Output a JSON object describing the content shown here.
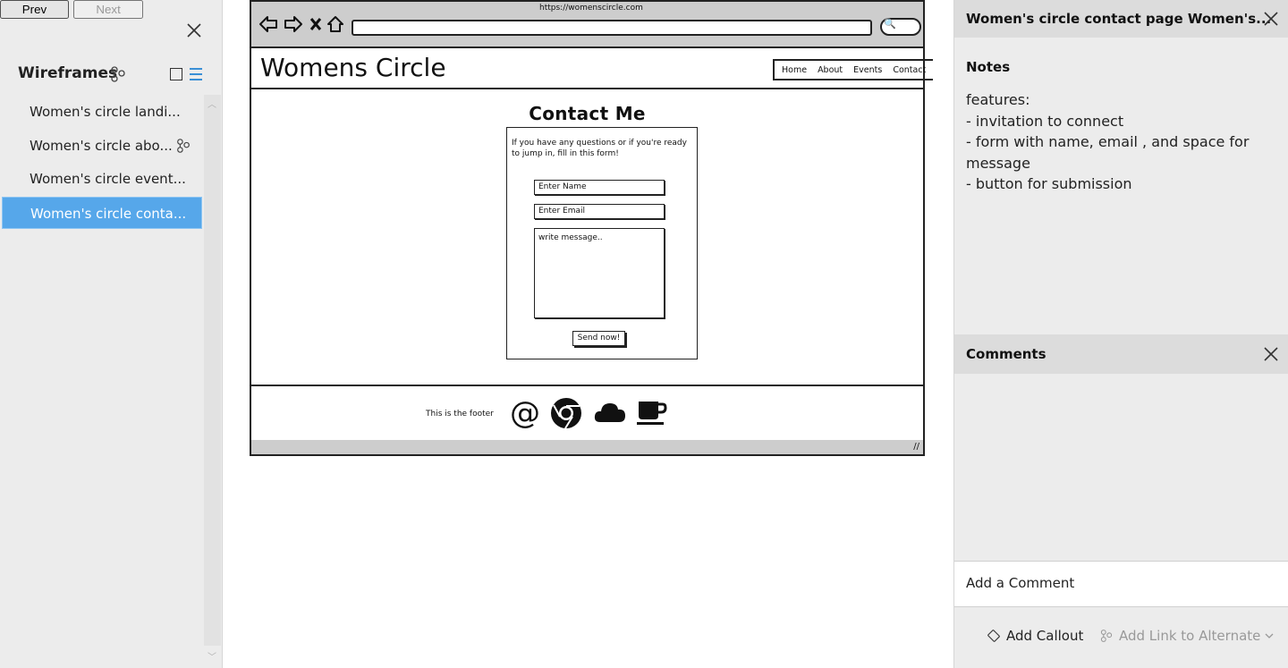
{
  "left": {
    "prev_label": "Prev",
    "next_label": "Next",
    "title": "Wireframes",
    "items": [
      {
        "label": "Women's circle landi...",
        "selected": false
      },
      {
        "label": "Women's circle abo...",
        "selected": false
      },
      {
        "label": "Women's circle event...",
        "selected": false
      },
      {
        "label": "Women's circle conta...",
        "selected": true
      }
    ]
  },
  "wireframe": {
    "url": "https://womenscircle.com",
    "site_title": "Womens Circle",
    "nav": [
      "Home",
      "About",
      "Events",
      "Contact"
    ],
    "heading": "Contact Me",
    "intro": "If you have any questions or if you're ready to jump in, fill in this form!",
    "name_placeholder": "Enter Name",
    "email_placeholder": "Enter Email",
    "message_placeholder": "write message..",
    "send_label": "Send now!",
    "footer_text": "This is the footer"
  },
  "right": {
    "title": "Women's circle contact page Women's...",
    "notes_label": "Notes",
    "notes_lines": [
      "features:",
      "- invitation to connect",
      "- form with name, email , and space for message",
      "- button for submission"
    ],
    "comments_title": "Comments",
    "add_comment": "Add a Comment",
    "add_callout": "Add Callout",
    "add_link": "Add Link to Alternate"
  },
  "colors": {
    "selection": "#56a7ea",
    "accent": "#3a8fd6"
  }
}
